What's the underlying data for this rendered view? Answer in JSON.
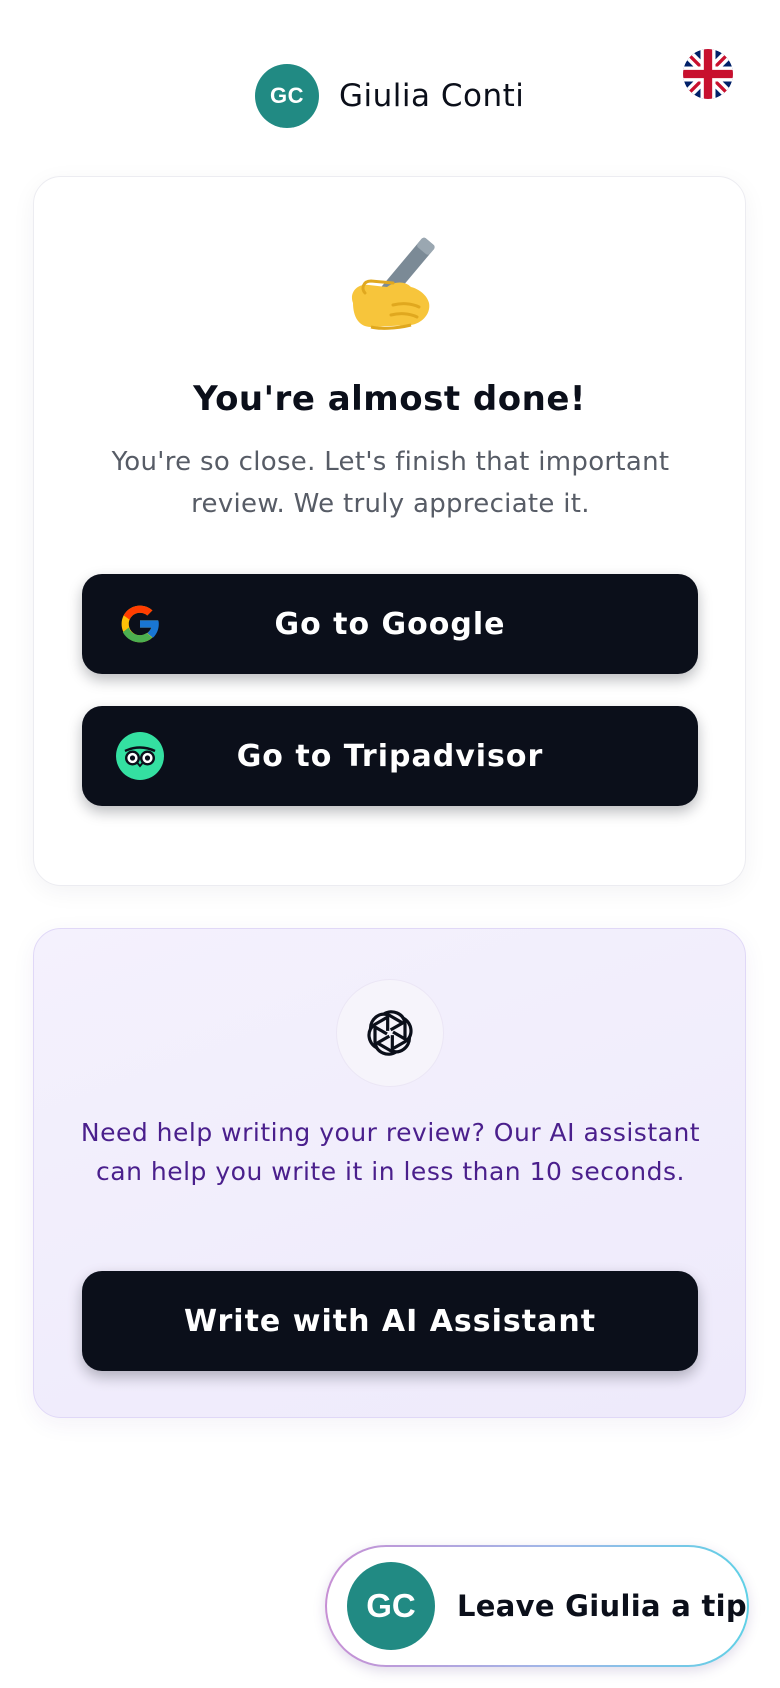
{
  "header": {
    "avatar_initials": "GC",
    "profile_name": "Giulia Conti",
    "language_flag": "uk-flag-icon"
  },
  "review_card": {
    "emoji": "writing-hand-icon",
    "title": "You're almost done!",
    "subtitle": "You're so close. Let's finish that important review. We truly appreciate it.",
    "buttons": [
      {
        "label": "Go to Google",
        "icon": "google-icon"
      },
      {
        "label": "Go to Tripadvisor",
        "icon": "tripadvisor-icon"
      }
    ]
  },
  "ai_card": {
    "icon": "openai-icon",
    "text": "Need help writing your review? Our AI assistant can help you write it in less than 10 seconds.",
    "button_label": "Write with AI Assistant"
  },
  "tip": {
    "avatar_initials": "GC",
    "label": "Leave Giulia a tip"
  },
  "colors": {
    "avatar_bg": "#218a83",
    "button_bg": "#0b0f1a",
    "ai_text": "#4a1f8c",
    "tripadvisor_green": "#34e0a1"
  }
}
